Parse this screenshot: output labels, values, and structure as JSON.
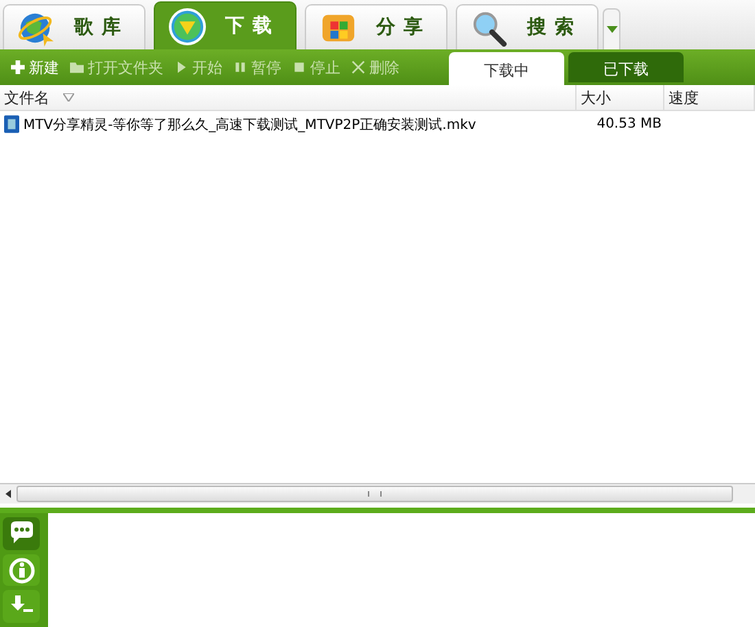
{
  "main_tabs": [
    {
      "label": "歌库",
      "selected": false,
      "kind": "globe"
    },
    {
      "label": "下载",
      "selected": true,
      "kind": "download"
    },
    {
      "label": "分享",
      "selected": false,
      "kind": "share"
    },
    {
      "label": "搜索",
      "selected": false,
      "kind": "search"
    }
  ],
  "toolbar": [
    {
      "label": "新建",
      "kind": "new",
      "disabled": false
    },
    {
      "label": "打开文件夹",
      "kind": "folder",
      "disabled": true
    },
    {
      "label": "开始",
      "kind": "start",
      "disabled": true
    },
    {
      "label": "暂停",
      "kind": "pause",
      "disabled": true
    },
    {
      "label": "停止",
      "kind": "stop",
      "disabled": true
    },
    {
      "label": "删除",
      "kind": "delete",
      "disabled": true
    }
  ],
  "sub_tabs": [
    {
      "label": "下载中",
      "selected": true
    },
    {
      "label": "已下载",
      "selected": false
    }
  ],
  "table": {
    "columns": [
      "文件名",
      "大小",
      "速度"
    ],
    "rows": [
      {
        "name": "MTV分享精灵-等你等了那么久_高速下载测试_MTVP2P正确安装测试.mkv",
        "size": "40.53 MB"
      }
    ]
  },
  "side_panel": [
    {
      "kind": "chat",
      "selected": true
    },
    {
      "kind": "info",
      "selected": false
    },
    {
      "kind": "download",
      "selected": false
    }
  ]
}
